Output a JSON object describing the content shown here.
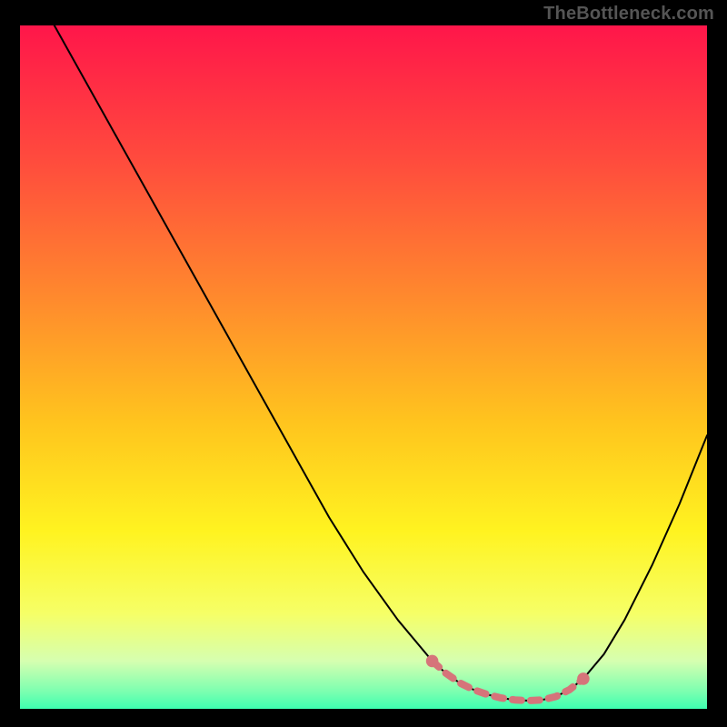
{
  "watermark": "TheBottleneck.com",
  "chart_data": {
    "type": "line",
    "title": "",
    "xlabel": "",
    "ylabel": "",
    "xlim": [
      0,
      100
    ],
    "ylim": [
      0,
      100
    ],
    "grid": false,
    "legend": false,
    "background": {
      "type": "vertical-gradient",
      "stops": [
        {
          "offset": 0.0,
          "color": "#ff164a"
        },
        {
          "offset": 0.2,
          "color": "#ff4c3d"
        },
        {
          "offset": 0.4,
          "color": "#ff8a2d"
        },
        {
          "offset": 0.58,
          "color": "#ffc41e"
        },
        {
          "offset": 0.74,
          "color": "#fff320"
        },
        {
          "offset": 0.86,
          "color": "#f6ff66"
        },
        {
          "offset": 0.93,
          "color": "#d6ffb0"
        },
        {
          "offset": 0.975,
          "color": "#7bffb0"
        },
        {
          "offset": 1.0,
          "color": "#3dffb0"
        }
      ]
    },
    "series": [
      {
        "name": "curve",
        "stroke": "#000000",
        "stroke_width": 2,
        "x": [
          5,
          10,
          15,
          20,
          25,
          30,
          35,
          40,
          45,
          50,
          55,
          60,
          62,
          64,
          66,
          68,
          70,
          72,
          74,
          76,
          78,
          80,
          82,
          85,
          88,
          92,
          96,
          100
        ],
        "y": [
          100,
          91,
          82,
          73,
          64,
          55,
          46,
          37,
          28,
          20,
          13,
          7,
          5.2,
          3.8,
          2.8,
          2.1,
          1.6,
          1.3,
          1.2,
          1.3,
          1.8,
          2.8,
          4.4,
          8,
          13,
          21,
          30,
          40
        ]
      },
      {
        "name": "trough-marker",
        "stroke": "#d6747a",
        "stroke_width": 8,
        "x": [
          60,
          62,
          64,
          66,
          68,
          70,
          72,
          74,
          76,
          78,
          80,
          82
        ],
        "y": [
          7,
          5.2,
          3.8,
          2.8,
          2.1,
          1.6,
          1.3,
          1.2,
          1.3,
          1.8,
          2.8,
          4.4
        ],
        "marker_endpoints": true
      }
    ]
  }
}
